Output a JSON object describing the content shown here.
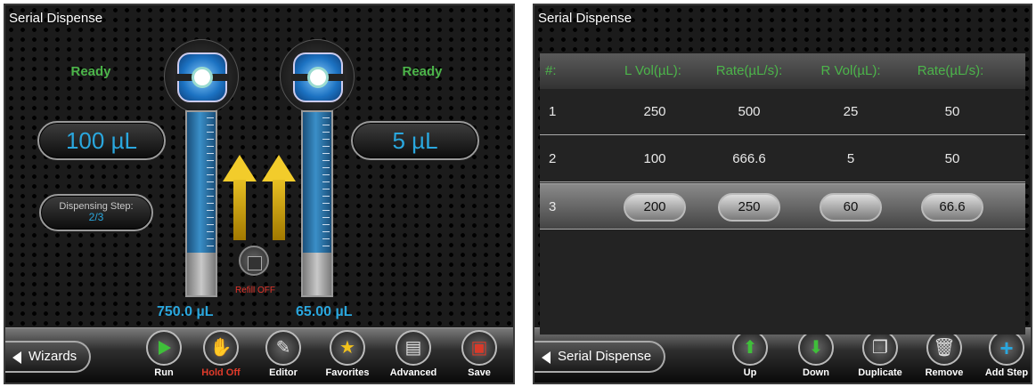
{
  "left": {
    "title": "Serial Dispense",
    "left_status": "Ready",
    "right_status": "Ready",
    "left_volume": "100 µL",
    "right_volume": "5 µL",
    "dispensing_step_label": "Dispensing Step:",
    "dispensing_step_value": "2/3",
    "refill_label": "Refill OFF",
    "left_syringe_level": "750.0 µL",
    "right_syringe_level": "65.00 µL",
    "toolbar": {
      "back_label": "Wizards",
      "buttons": [
        {
          "label": "Run",
          "icon": "play-icon",
          "color": "#3fbf3a"
        },
        {
          "label": "Hold Off",
          "icon": "hand-icon",
          "color": "#e03a2a"
        },
        {
          "label": "Editor",
          "icon": "editor-icon",
          "color": "#d8d8d8"
        },
        {
          "label": "Favorites",
          "icon": "star-icon",
          "color": "#f2c21b"
        },
        {
          "label": "Advanced",
          "icon": "window-icon",
          "color": "#d8d8d8"
        },
        {
          "label": "Save",
          "icon": "floppy-icon",
          "color": "#d83a2a"
        }
      ]
    }
  },
  "right": {
    "title": "Serial Dispense",
    "columns": [
      "#:",
      "L Vol(µL):",
      "Rate(µL/s):",
      "R Vol(µL):",
      "Rate(µL/s):"
    ],
    "rows": [
      [
        "1",
        "250",
        "500",
        "25",
        "50"
      ],
      [
        "2",
        "100",
        "666.6",
        "5",
        "50"
      ],
      [
        "3",
        "200",
        "250",
        "60",
        "66.6"
      ]
    ],
    "selected_row": 3,
    "toolbar": {
      "back_label": "Serial Dispense",
      "buttons": [
        {
          "label": "Up",
          "icon": "arrow-up-icon",
          "color": "#3fbf3a"
        },
        {
          "label": "Down",
          "icon": "arrow-down-icon",
          "color": "#3fbf3a"
        },
        {
          "label": "Duplicate",
          "icon": "duplicate-icon",
          "color": "#d8d8d8"
        },
        {
          "label": "Remove",
          "icon": "trash-icon",
          "color": "#d8d8d8"
        },
        {
          "label": "Add Step",
          "icon": "plus-icon",
          "color": "#2aa7de"
        }
      ]
    }
  },
  "colors": {
    "status_green": "#4cb54a",
    "value_blue": "#2aa7de",
    "refill_red": "#e4352b"
  }
}
